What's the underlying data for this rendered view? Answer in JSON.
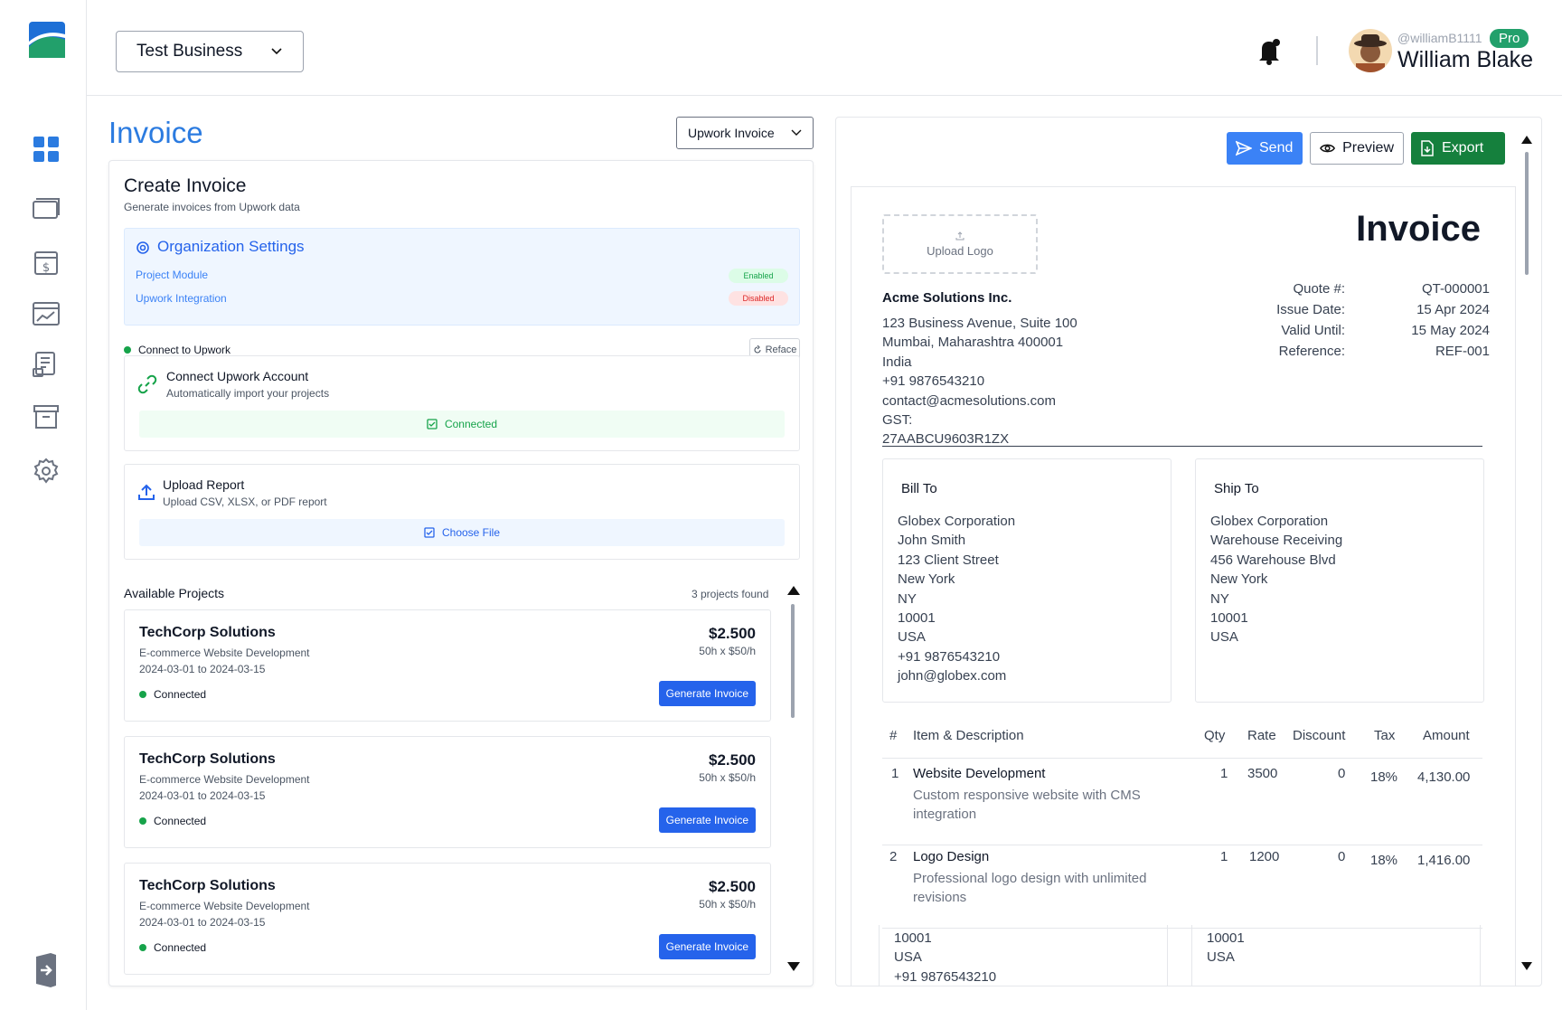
{
  "header": {
    "business": "Test Business",
    "user_handle": "@williamB1111",
    "badge": "Pro",
    "user_name": "William Blake"
  },
  "sidebar": {
    "icons": [
      "dashboard-icon",
      "cards-icon",
      "invoice-dollar-icon",
      "analytics-icon",
      "reports-icon",
      "archive-icon",
      "settings-icon"
    ],
    "logout_icon": "logout-icon"
  },
  "main": {
    "title": "Invoice",
    "template_select": "Upwork Invoice"
  },
  "create": {
    "title": "Create Invoice",
    "subtitle": "Generate invoices from Upwork data",
    "org": {
      "title": "Organization Settings",
      "rows": [
        {
          "label": "Project Module",
          "status": "Enabled"
        },
        {
          "label": "Upwork Integration",
          "status": "Disabled"
        }
      ]
    },
    "connect_label": "Connect to Upwork",
    "reface_label": "Reface",
    "connect_card": {
      "title": "Connect Upwork Account",
      "subtitle": "Automatically import your projects",
      "button": "Connected"
    },
    "upload_card": {
      "title": "Upload Report",
      "subtitle": "Upload CSV, XLSX, or PDF report",
      "button": "Choose File"
    },
    "available_title": "Available Projects",
    "projects_count": "3 projects found",
    "projects": [
      {
        "name": "TechCorp Solutions",
        "desc": "E-commerce Website Development",
        "dates": "2024-03-01 to 2024-03-15",
        "status": "Connected",
        "amount": "$2.500",
        "rate": "50h x $50/h",
        "button": "Generate Invoice"
      },
      {
        "name": "TechCorp Solutions",
        "desc": "E-commerce Website Development",
        "dates": "2024-03-01 to 2024-03-15",
        "status": "Connected",
        "amount": "$2.500",
        "rate": "50h x $50/h",
        "button": "Generate Invoice"
      },
      {
        "name": "TechCorp Solutions",
        "desc": "E-commerce Website Development",
        "dates": "2024-03-01 to 2024-03-15",
        "status": "Connected",
        "amount": "$2.500",
        "rate": "50h x $50/h",
        "button": "Generate Invoice"
      }
    ]
  },
  "preview": {
    "send": "Send",
    "preview": "Preview",
    "export": "Export",
    "upload_logo": "Upload Logo",
    "doc_title": "Invoice",
    "meta": [
      {
        "label": "Quote #:",
        "value": "QT-000001"
      },
      {
        "label": "Issue Date:",
        "value": "15 Apr 2024"
      },
      {
        "label": "Valid Until:",
        "value": "15 May 2024"
      },
      {
        "label": "Reference:",
        "value": "REF-001"
      }
    ],
    "company_name": "Acme Solutions Inc.",
    "company_lines": [
      "123 Business Avenue, Suite 100",
      "Mumbai, Maharashtra 400001",
      "India",
      "+91 9876543210",
      "contact@acmesolutions.com",
      "GST:",
      "27AABCU9603R1ZX"
    ],
    "bill_to": {
      "title": "Bill To",
      "lines": [
        "Globex Corporation",
        "John Smith",
        "123 Client Street",
        "New York",
        "NY",
        "10001",
        "USA",
        "+91 9876543210",
        "john@globex.com"
      ]
    },
    "ship_to": {
      "title": "Ship To",
      "lines": [
        "Globex Corporation",
        "Warehouse Receiving",
        "456 Warehouse Blvd",
        "New York",
        "NY",
        "10001",
        "USA"
      ]
    },
    "columns": [
      "#",
      "Item & Description",
      "Qty",
      "Rate",
      "Discount",
      "Tax",
      "Amount"
    ],
    "items": [
      {
        "num": "1",
        "name": "Website Development",
        "desc": "Custom responsive website with CMS integration",
        "qty": "1",
        "rate": "3500",
        "discount": "0",
        "tax": "18%",
        "amount": "4,130.00"
      },
      {
        "num": "2",
        "name": "Logo Design",
        "desc": "Professional logo design with unlimited revisions",
        "qty": "1",
        "rate": "1200",
        "discount": "0",
        "tax": "18%",
        "amount": "1,416.00"
      }
    ],
    "ghost_left": [
      "10001",
      "USA",
      "+91 9876543210"
    ],
    "ghost_right": [
      "10001",
      "USA"
    ]
  }
}
